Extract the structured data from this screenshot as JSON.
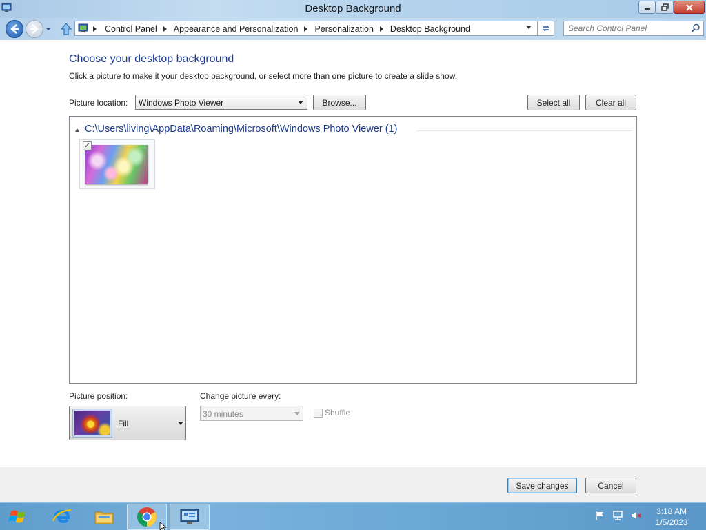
{
  "window": {
    "title": "Desktop Background"
  },
  "address_bar": {
    "crumbs": [
      "Control Panel",
      "Appearance and Personalization",
      "Personalization",
      "Desktop Background"
    ],
    "search_placeholder": "Search Control Panel"
  },
  "main": {
    "heading": "Choose your desktop background",
    "description": "Click a picture to make it your desktop background, or select more than one picture to create a slide show.",
    "picture_location_label": "Picture location:",
    "picture_location_value": "Windows Photo Viewer",
    "browse_label": "Browse...",
    "select_all_label": "Select all",
    "clear_all_label": "Clear all",
    "group_title": "C:\\Users\\living\\AppData\\Roaming\\Microsoft\\Windows Photo Viewer (1)",
    "thumbnail_checked": true,
    "thumbnail_check_glyph": "✓"
  },
  "options": {
    "picture_position_label": "Picture position:",
    "picture_position_value": "Fill",
    "change_picture_label": "Change picture every:",
    "change_picture_value": "30 minutes",
    "shuffle_label": "Shuffle"
  },
  "footer": {
    "save_label": "Save changes",
    "cancel_label": "Cancel"
  },
  "taskbar": {
    "items": [
      "start-button",
      "internet-explorer-icon",
      "file-explorer-icon",
      "chrome-icon",
      "control-panel-icon"
    ],
    "clock_time": "3:18 AM",
    "clock_date": "1/5/2023"
  },
  "colors": {
    "heading_blue": "#1e3d8f",
    "taskbar": "#6aa8d6",
    "titlebar": "#b3d2ec"
  }
}
